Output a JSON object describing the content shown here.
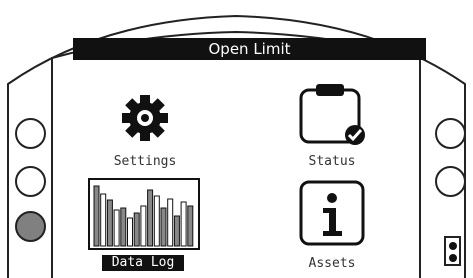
{
  "screen": {
    "title": "Open Limit"
  },
  "menu": {
    "items": [
      {
        "label": "Settings",
        "icon": "gear-icon"
      },
      {
        "label": "Status",
        "icon": "clipboard-check-icon"
      },
      {
        "label": "Data Log",
        "icon": "bar-chart-icon",
        "selected": true
      },
      {
        "label": "Assets",
        "icon": "info-icon"
      }
    ]
  },
  "colors": {
    "title_bar": "#111111",
    "selected_button": "#808080",
    "outline": "#222222"
  }
}
